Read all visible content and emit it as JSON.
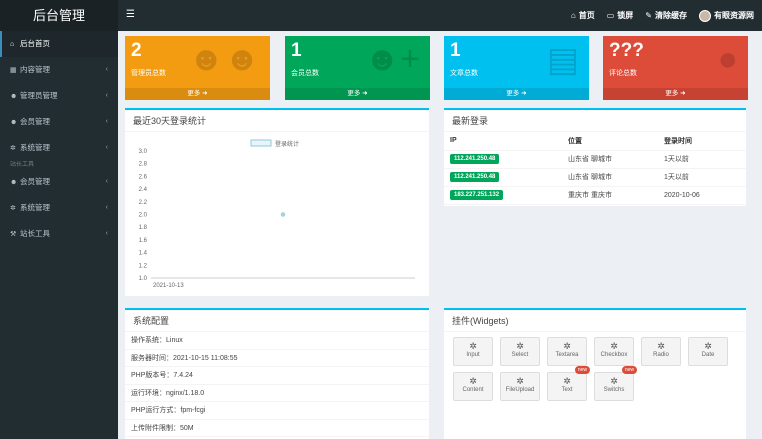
{
  "app": {
    "brand": "后台管理"
  },
  "topnav": {
    "home": "首页",
    "lock": "锁屏",
    "clear_cache": "清除缓存",
    "site_name": "有眼资源网"
  },
  "sidebar": {
    "items": [
      {
        "label": "后台首页",
        "icon": "home-icon"
      },
      {
        "label": "内容管理",
        "icon": "grid-icon"
      },
      {
        "label": "管理员管理",
        "icon": "users-icon"
      },
      {
        "label": "会员管理",
        "icon": "users-icon"
      },
      {
        "label": "系统管理",
        "icon": "gear-icon"
      }
    ],
    "ghost_label": "站长工具",
    "items2": [
      {
        "label": "会员管理",
        "icon": "users-icon"
      },
      {
        "label": "系统管理",
        "icon": "gear-icon"
      },
      {
        "label": "站长工具",
        "icon": "wrench-icon"
      }
    ]
  },
  "tiles": [
    {
      "value": "2",
      "label": "管理员总数",
      "more": "更多",
      "color": "#f39c12",
      "icon": "users-icon"
    },
    {
      "value": "1",
      "label": "会员总数",
      "more": "更多",
      "color": "#00a65a",
      "icon": "user-add-icon"
    },
    {
      "value": "1",
      "label": "文章总数",
      "more": "更多",
      "color": "#00c0ef",
      "icon": "document-icon"
    },
    {
      "value": "???",
      "label": "评论总数",
      "more": "更多",
      "color": "#dd4b39",
      "icon": "comment-icon"
    }
  ],
  "login_chart": {
    "title": "最近30天登录统计"
  },
  "chart_data": {
    "type": "line",
    "title": "",
    "legend": "登录统计",
    "legend_position": "top-center",
    "x": [
      "2021-10-13"
    ],
    "series": [
      {
        "name": "登录统计",
        "values": [
          2
        ]
      }
    ],
    "ylim": [
      1.0,
      3.0
    ],
    "yticks": [
      "3.0",
      "2.8",
      "2.6",
      "2.4",
      "2.2",
      "2.0",
      "1.8",
      "1.6",
      "1.4",
      "1.2",
      "1.0"
    ],
    "grid": false
  },
  "recent_login": {
    "title": "最新登录",
    "headers": [
      "IP",
      "位置",
      "登录时间"
    ],
    "rows": [
      {
        "ip": "112.241.250.48",
        "location": "山东省 聊城市",
        "time": "1天以前"
      },
      {
        "ip": "112.241.250.48",
        "location": "山东省 聊城市",
        "time": "1天以前"
      },
      {
        "ip": "183.227.251.132",
        "location": "重庆市 重庆市",
        "time": "2020-10-06"
      }
    ]
  },
  "sys_config": {
    "title": "系统配置",
    "rows": [
      "操作系统：Linux",
      "服务器时间：2021-10-15 11:08:55",
      "PHP版本号：7.4.24",
      "运行环境：nginx/1.18.0",
      "PHP运行方式：fpm-fcgi",
      "上传附件限制：50M"
    ]
  },
  "widgets": {
    "title": "挂件(Widgets)",
    "items": [
      {
        "label": "Input"
      },
      {
        "label": "Select"
      },
      {
        "label": "Textarea"
      },
      {
        "label": "Checkbox"
      },
      {
        "label": "Radio"
      },
      {
        "label": "Date"
      },
      {
        "label": "Content"
      },
      {
        "label": "FileUpload"
      },
      {
        "label": "Text",
        "badge": "new"
      },
      {
        "label": "Switchs",
        "badge": "new"
      }
    ]
  }
}
